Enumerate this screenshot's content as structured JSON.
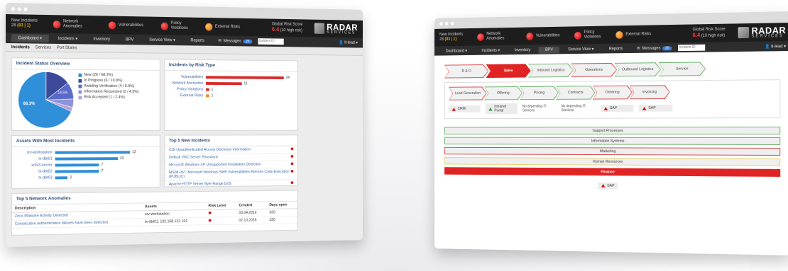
{
  "status": {
    "new_incidents_label": "New Incidents",
    "new_incidents_value": "28",
    "new_incidents_extra": "(83 | 1)",
    "items": [
      {
        "label": "Network Anomalies",
        "color": "red"
      },
      {
        "label": "Vulnerabilities",
        "color": "red"
      },
      {
        "label": "Policy Violations",
        "color": "red"
      },
      {
        "label": "External Risks",
        "color": "orange"
      }
    ],
    "risk_label": "Global Risk Score",
    "risk_value": "6.4",
    "risk_sub": "(10 high risk)"
  },
  "logo": {
    "main": "RADAR",
    "sub": "SERVICES"
  },
  "nav_left": {
    "items": [
      "Dashboard ▾",
      "Incidents ▾",
      "Inventory",
      "BPV",
      "Service View ▾",
      "Reports"
    ],
    "messages_label": "Messages",
    "messages_count": "26",
    "search_placeholder": "Incident ID",
    "user": "It-lead ▾"
  },
  "nav_right": {
    "items": [
      "Dashboard ▾",
      "Incidents ▾",
      "Inventory",
      "BPV",
      "Service View ▾",
      "Reports"
    ],
    "messages_label": "Messages",
    "messages_count": "26",
    "search_placeholder": "Incident ID",
    "user": "It-lead ▾"
  },
  "subnav": {
    "items": [
      "Incidents",
      "Services",
      "Port States"
    ]
  },
  "incident_status": {
    "title": "Incident Status Overview",
    "legend": [
      {
        "label": "New (26 / 68.3%)",
        "color": "#2f8fd8"
      },
      {
        "label": "In Progress (6 / 19.8%)",
        "color": "#3b4a9a"
      },
      {
        "label": "Awaiting Verification (4 / 9.9%)",
        "color": "#5a6ac8"
      },
      {
        "label": "Information Requested (2 / 4.9%)",
        "color": "#8c93d8"
      },
      {
        "label": "Risk Accepted (1 / 2.4%)",
        "color": "#b7a3d8"
      }
    ],
    "pie_label_big": "68.3%",
    "pie_label_small": "14.5%"
  },
  "chart_data": [
    {
      "type": "pie",
      "title": "Incident Status Overview",
      "categories": [
        "New",
        "In Progress",
        "Awaiting Verification",
        "Information Requested",
        "Risk Accepted"
      ],
      "values": [
        68.3,
        14.5,
        9.9,
        4.9,
        2.4
      ],
      "colors": [
        "#2f8fd8",
        "#3b4a9a",
        "#5a6ac8",
        "#8c93d8",
        "#b7a3d8"
      ]
    },
    {
      "type": "bar",
      "title": "Incidents by Risk Type",
      "categories": [
        "Vulnerabilities",
        "Network Anomalies",
        "Policy Violations",
        "External Risks"
      ],
      "values": [
        24,
        11,
        1,
        1
      ],
      "colors": [
        "#d62b2b",
        "#d62b2b",
        "#d62b2b",
        "#f08a1a"
      ],
      "xlim": [
        0,
        24
      ]
    },
    {
      "type": "bar",
      "title": "Assets With Most Incidents",
      "categories": [
        "srv-workstation",
        "tx-dbt01",
        "w2k3-server",
        "tx-dbt02",
        "tx-dbt03"
      ],
      "values": [
        12,
        10,
        7,
        7,
        2
      ],
      "colors": [
        "#2f8fd8",
        "#2f8fd8",
        "#2f8fd8",
        "#2f8fd8",
        "#2f8fd8"
      ],
      "xlim": [
        0,
        12
      ]
    }
  ],
  "top_incidents": {
    "title": "Top 5 New Incidents",
    "items": [
      "CGI Unauthenticated Access Discloses Information",
      "Default VNC Server Password",
      "Microsoft Windows XP Unsupported Installation Detection",
      "MS08-067: Microsoft Windows SMB Vulnerabilities Remote Code Execution (PUBLIC)",
      "Apache HTTP Server Byte Range DoS"
    ]
  },
  "anomalies": {
    "title": "Top 5 Network Anomalies",
    "headers": [
      "Description",
      "Assets",
      "Risk Level",
      "Created",
      "Days open"
    ],
    "rows": [
      [
        "Zeus Malware Activity Detected",
        "srv-workstation",
        "",
        "03.04.2016",
        "330"
      ],
      [
        "Consecutive authentication failures have been detected",
        "tx-dbt01, 192.168.122.101",
        "",
        "02.10.2016",
        "330"
      ]
    ]
  },
  "value_chain": {
    "main": [
      {
        "label": "R & D",
        "style": "red"
      },
      {
        "label": "Sales",
        "style": "redfill"
      },
      {
        "label": "Inbound Logistics",
        "style": "green"
      },
      {
        "label": "Operations",
        "style": "red"
      },
      {
        "label": "Outbound Logistics",
        "style": "green"
      },
      {
        "label": "Service",
        "style": "green"
      }
    ],
    "sub": [
      {
        "label": "Lead Generation",
        "style": "red"
      },
      {
        "label": "Offering",
        "style": "green"
      },
      {
        "label": "Pricing",
        "style": "green"
      },
      {
        "label": "Contracts",
        "style": "green"
      },
      {
        "label": "Ordering",
        "style": "red"
      },
      {
        "label": "Invoicing",
        "style": "red"
      }
    ],
    "systems": [
      {
        "label": "CRM",
        "tri": "red"
      },
      {
        "label": "Intranet Portal",
        "tri": "green"
      },
      {
        "label": "No depending IT- Services",
        "tri": ""
      },
      {
        "label": "No depending IT- Services",
        "tri": ""
      },
      {
        "label": "SAP",
        "tri": "red"
      },
      {
        "label": "SAP",
        "tri": "red"
      }
    ],
    "support": [
      {
        "label": "Support Processes",
        "style": "g"
      },
      {
        "label": "Information Systems",
        "style": "g"
      },
      {
        "label": "Marketing",
        "style": "r"
      },
      {
        "label": "Human Resources",
        "style": "y"
      },
      {
        "label": "Finance",
        "style": "fill"
      }
    ],
    "finance_system": "SAP"
  }
}
